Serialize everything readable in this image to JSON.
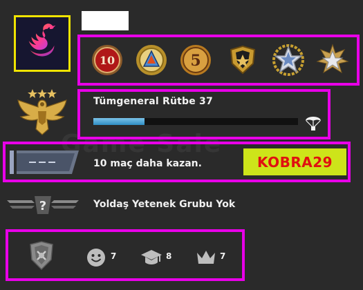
{
  "profile": {
    "avatar_icon": "swan-logo-icon",
    "name": ""
  },
  "medals": [
    {
      "icon": "medal-10-icon",
      "label": "10"
    },
    {
      "icon": "medal-triangle-icon",
      "label": ""
    },
    {
      "icon": "medal-5-icon",
      "label": "5"
    },
    {
      "icon": "medal-shield-icon",
      "label": ""
    },
    {
      "icon": "medal-star-wreath-icon",
      "label": ""
    },
    {
      "icon": "medal-star-gold-icon",
      "label": ""
    }
  ],
  "rank": {
    "title": "Tümgeneral Rütbe 37",
    "progress": 0.25,
    "rank_icon": "eagle-rank-icon",
    "xp_icon": "parachute-icon"
  },
  "competitive": {
    "message": "10 maç daha kazan.",
    "code": "KOBRA29",
    "rank_badge_icon": "unranked-badge-icon"
  },
  "wingman": {
    "message": "Yoldaş Yetenek Grubu Yok",
    "icon": "wingman-unranked-icon"
  },
  "commendations": {
    "emblem_icon": "service-emblem-icon",
    "friendly": {
      "icon": "smiley-icon",
      "value": "7"
    },
    "teacher": {
      "icon": "graduation-cap-icon",
      "value": "8"
    },
    "leader": {
      "icon": "crown-icon",
      "value": "7"
    }
  },
  "watermark": "Game Sale"
}
